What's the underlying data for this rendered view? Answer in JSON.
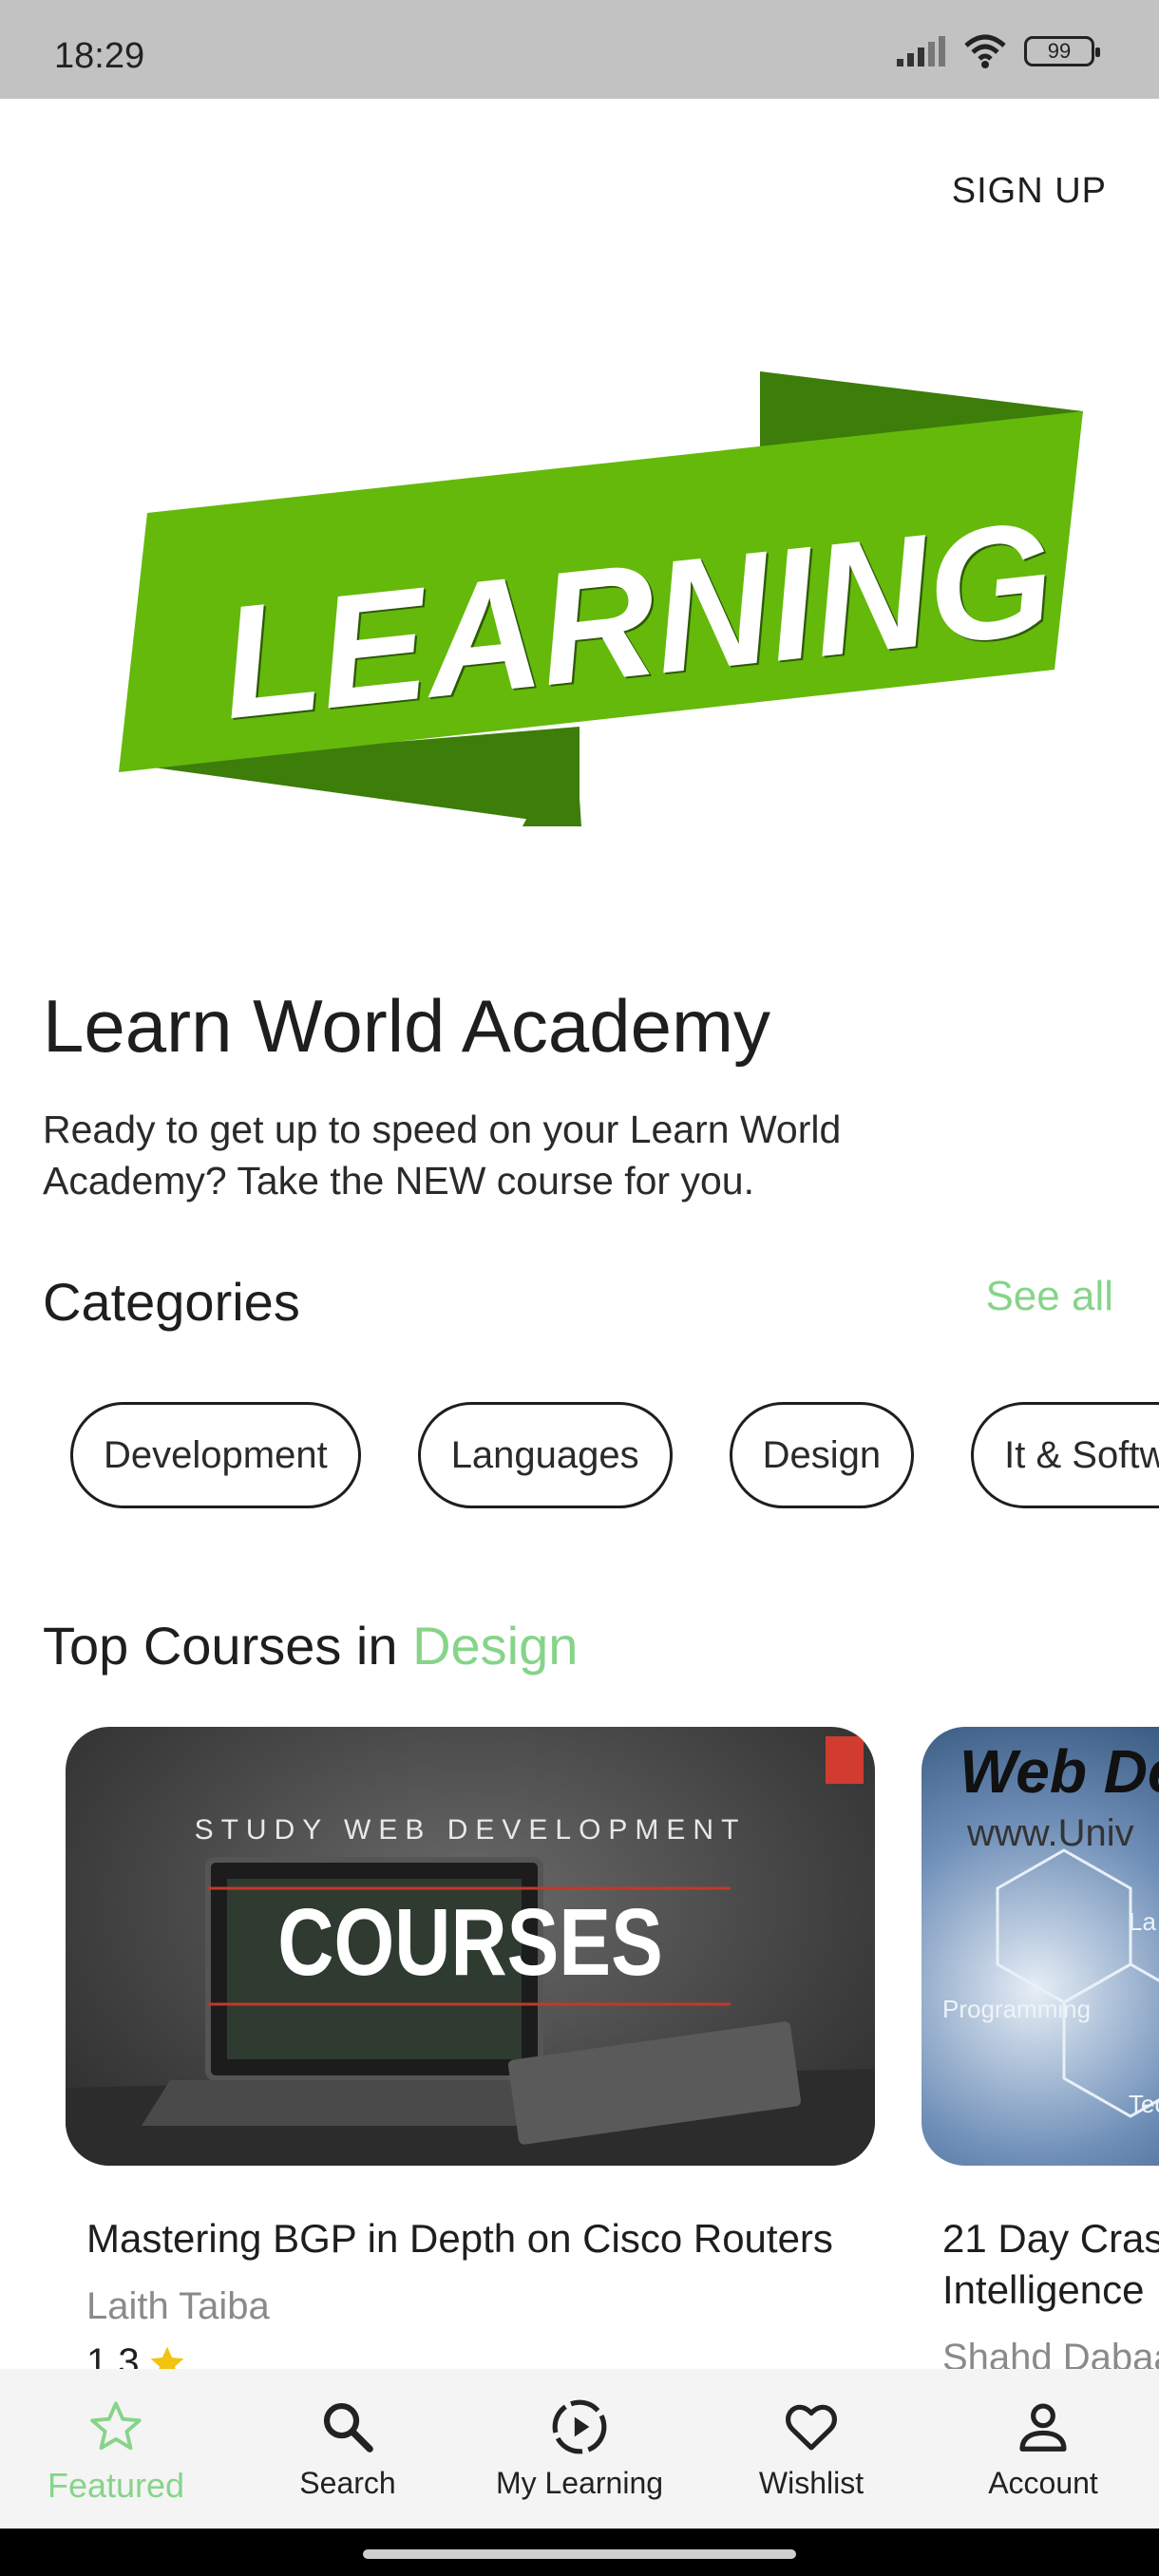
{
  "status_bar": {
    "time": "18:29",
    "battery": "99"
  },
  "header": {
    "signup_label": "SIGN UP"
  },
  "banner": {
    "text": "LEARNING"
  },
  "hero": {
    "title": "Learn World Academy",
    "subtitle": "Ready to get up to speed on your Learn World Academy? Take the NEW course for you."
  },
  "categories": {
    "title": "Categories",
    "see_all": "See all",
    "items": [
      "Development",
      "Languages",
      "Design",
      "It & Softw"
    ]
  },
  "top_courses": {
    "prefix": "Top Courses in ",
    "category": "Design",
    "courses": [
      {
        "thumb_top": "STUDY WEB DEVELOPMENT",
        "thumb_main": "COURSES",
        "title": "Mastering BGP in Depth on Cisco Routers",
        "author": "Laith Taiba",
        "rating": "1.3"
      },
      {
        "thumb_top": "Web De",
        "thumb_sub": "www.Univ",
        "thumb_label_1": "Programming",
        "thumb_label_2": "La",
        "thumb_label_3": "Tec",
        "title": "21 Day Cras\nIntelligence",
        "author": "Shahd Dabaa"
      }
    ]
  },
  "bottom_nav": {
    "items": [
      {
        "label": "Featured",
        "icon": "star-icon",
        "active": true
      },
      {
        "label": "Search",
        "icon": "search-icon"
      },
      {
        "label": "My Learning",
        "icon": "play-circle-icon"
      },
      {
        "label": "Wishlist",
        "icon": "heart-icon"
      },
      {
        "label": "Account",
        "icon": "person-icon"
      }
    ]
  },
  "colors": {
    "accent": "#86d48a",
    "banner_green": "#64b90b",
    "banner_dark": "#3d7d0a"
  }
}
